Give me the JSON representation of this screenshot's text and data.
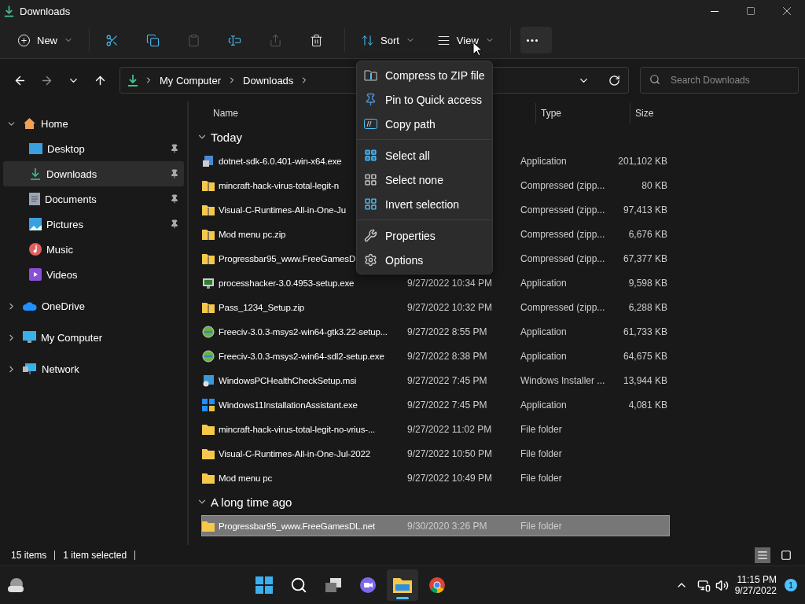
{
  "window": {
    "title": "Downloads"
  },
  "toolbar": {
    "new": {
      "label": "New"
    },
    "actions": [
      {
        "kind": "cut",
        "disabled": false
      },
      {
        "kind": "copy",
        "disabled": false
      },
      {
        "kind": "paste",
        "disabled": true
      },
      {
        "kind": "rename",
        "disabled": false
      },
      {
        "kind": "share",
        "disabled": true
      },
      {
        "kind": "delete",
        "disabled": false
      }
    ],
    "sort": {
      "label": "Sort"
    },
    "view": {
      "label": "View"
    },
    "more": {
      "hovered": true
    }
  },
  "address": {
    "path": [
      "My Computer",
      "Downloads"
    ]
  },
  "search": {
    "placeholder": "Search Downloads"
  },
  "sidebar": {
    "items": [
      {
        "label": "Home",
        "kind": "home",
        "expanded": true,
        "selected": false,
        "children": [
          {
            "label": "Desktop",
            "kind": "desktop",
            "pinned": true,
            "selected": false
          },
          {
            "label": "Downloads",
            "kind": "downloads",
            "pinned": true,
            "selected": true
          },
          {
            "label": "Documents",
            "kind": "documents",
            "pinned": true,
            "selected": false
          },
          {
            "label": "Pictures",
            "kind": "pictures",
            "pinned": true,
            "selected": false
          },
          {
            "label": "Music",
            "kind": "music",
            "pinned": false,
            "selected": false
          },
          {
            "label": "Videos",
            "kind": "videos",
            "pinned": false,
            "selected": false
          }
        ]
      },
      {
        "label": "OneDrive",
        "kind": "cloud",
        "expanded": false,
        "selected": false
      },
      {
        "label": "My Computer",
        "kind": "computer",
        "expanded": false,
        "selected": false
      },
      {
        "label": "Network",
        "kind": "network",
        "expanded": false,
        "selected": false
      }
    ]
  },
  "columns": [
    {
      "label": "Name"
    },
    {
      "label": "Type"
    },
    {
      "label": "Size"
    }
  ],
  "groups": [
    {
      "label": "Today",
      "expanded": true,
      "rows": [
        {
          "name": "dotnet-sdk-6.0.401-win-x64.exe",
          "type": "Application",
          "size": "201,102 KB",
          "kind": "installer",
          "selected": false
        },
        {
          "name": "mincraft-hack-virus-total-legit-n",
          "type": "Compressed (zipp...",
          "size": "80 KB",
          "kind": "zip",
          "selected": false
        },
        {
          "name": "Visual-C-Runtimes-All-in-One-Ju",
          "type": "Compressed (zipp...",
          "size": "97,413 KB",
          "kind": "zip",
          "selected": false
        },
        {
          "name": "Mod menu pc.zip",
          "type": "Compressed (zipp...",
          "size": "6,676 KB",
          "kind": "zip",
          "selected": false
        },
        {
          "name": "Progressbar95_www.FreeGamesD",
          "type": "Compressed (zipp...",
          "size": "67,377 KB",
          "kind": "zip",
          "selected": false
        },
        {
          "name": "processhacker-3.0.4953-setup.exe",
          "date": "9/27/2022 10:34 PM",
          "type": "Application",
          "size": "9,598 KB",
          "kind": "monitor",
          "selected": false
        },
        {
          "name": "Pass_1234_Setup.zip",
          "date": "9/27/2022 10:32 PM",
          "type": "Compressed (zipp...",
          "size": "6,288 KB",
          "kind": "zip",
          "selected": false
        },
        {
          "name": "Freeciv-3.0.3-msys2-win64-gtk3.22-setup...",
          "date": "9/27/2022 8:55 PM",
          "type": "Application",
          "size": "61,733 KB",
          "kind": "globe",
          "selected": false
        },
        {
          "name": "Freeciv-3.0.3-msys2-win64-sdl2-setup.exe",
          "date": "9/27/2022 8:38 PM",
          "type": "Application",
          "size": "64,675 KB",
          "kind": "globe",
          "selected": false
        },
        {
          "name": "WindowsPCHealthCheckSetup.msi",
          "date": "9/27/2022 7:45 PM",
          "type": "Windows Installer ...",
          "size": "13,944 KB",
          "kind": "msi",
          "selected": false
        },
        {
          "name": "Windows11InstallationAssistant.exe",
          "date": "9/27/2022 7:45 PM",
          "type": "Application",
          "size": "4,081 KB",
          "kind": "windows",
          "selected": false
        },
        {
          "name": "mincraft-hack-virus-total-legit-no-vrius-...",
          "date": "9/27/2022 11:02 PM",
          "type": "File folder",
          "kind": "folder",
          "selected": false
        },
        {
          "name": "Visual-C-Runtimes-All-in-One-Jul-2022",
          "date": "9/27/2022 10:50 PM",
          "type": "File folder",
          "kind": "folder",
          "selected": false
        },
        {
          "name": "Mod menu pc",
          "date": "9/27/2022 10:49 PM",
          "type": "File folder",
          "kind": "folder",
          "selected": false
        }
      ]
    },
    {
      "label": "A long time ago",
      "expanded": true,
      "rows": [
        {
          "name": "Progressbar95_www.FreeGamesDL.net",
          "date": "9/30/2020 3:26 PM",
          "type": "File folder",
          "kind": "folder",
          "selected": true
        }
      ]
    }
  ],
  "menu": {
    "sections": [
      [
        {
          "label": "Compress to ZIP file",
          "kind": "zip"
        },
        {
          "label": "Pin to Quick access",
          "kind": "pin"
        },
        {
          "label": "Copy path",
          "kind": "path"
        }
      ],
      [
        {
          "label": "Select all",
          "kind": "select-all"
        },
        {
          "label": "Select none",
          "kind": "select-none"
        },
        {
          "label": "Invert selection",
          "kind": "invert"
        }
      ],
      [
        {
          "label": "Properties",
          "kind": "properties"
        },
        {
          "label": "Options",
          "kind": "options"
        }
      ]
    ]
  },
  "status_bar": {
    "count": "15 items",
    "selection": "1 item selected",
    "views": [
      {
        "kind": "details",
        "selected": true
      },
      {
        "kind": "tiles",
        "selected": false
      }
    ]
  },
  "taskbar": {
    "apps": [
      {
        "kind": "start",
        "active": false
      },
      {
        "kind": "search",
        "active": false
      },
      {
        "kind": "taskview",
        "active": false
      },
      {
        "kind": "chat",
        "active": false
      },
      {
        "kind": "explorer",
        "active": true
      },
      {
        "kind": "browser",
        "active": false
      }
    ],
    "time": "11:15 PM",
    "date": "9/27/2022",
    "notifications": "1"
  }
}
